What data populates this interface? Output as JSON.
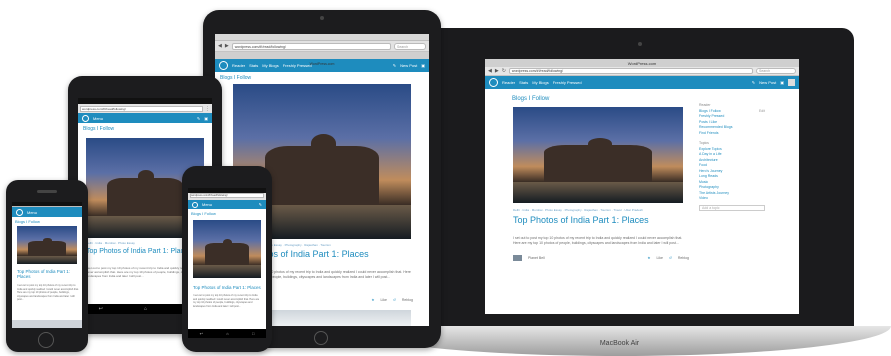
{
  "wp_nav": {
    "reader": "Reader",
    "stats": "Stats",
    "my_blogs": "My Blogs",
    "freshly_pressed": "Freshly Pressed",
    "new_post": "New Post",
    "menu": "Menu"
  },
  "browser": {
    "url": "wordpress.com/#!/read/following/",
    "tab_title": "WordPress.com",
    "search_placeholder": "Search"
  },
  "section_title": "Blogs I Follow",
  "post": {
    "title": "Top Photos of India Part 1: Places",
    "tags": [
      "Delhi",
      "India",
      "Mumbai",
      "Photo Essay",
      "Photography",
      "Rajasthan",
      "Tourism",
      "Travel",
      "Uttar Pradesh"
    ],
    "excerpt": "I set out to post my top 10 photos of my recent trip to India and quickly realized I could never accomplish that. Here are my top 10 photos of people, buildings, cityscapes and landscapes from India and later I will post...",
    "author": "Planet Bell",
    "like": "Like",
    "reblog": "Reblog"
  },
  "sidebar": {
    "reader_heading": "Reader",
    "reader_links": [
      "Blogs I Follow",
      "Freshly Pressed",
      "Posts I Like",
      "Recommended Blogs",
      "Find Friends"
    ],
    "edit_label": "Edit",
    "topics_heading": "Topics",
    "topics": [
      "Explore Topics",
      "A Day in a Life",
      "Architecture",
      "Food",
      "Hero's Journey",
      "Long Reads",
      "Music",
      "Photography",
      "The Artists Journey",
      "Video"
    ],
    "add_topic_placeholder": "Add a topic"
  },
  "macbook_label": "MacBook Air",
  "colors": {
    "wp_blue": "#1e8cbe",
    "link_blue": "#1e8cbe",
    "frame": "#1c1c1e"
  }
}
